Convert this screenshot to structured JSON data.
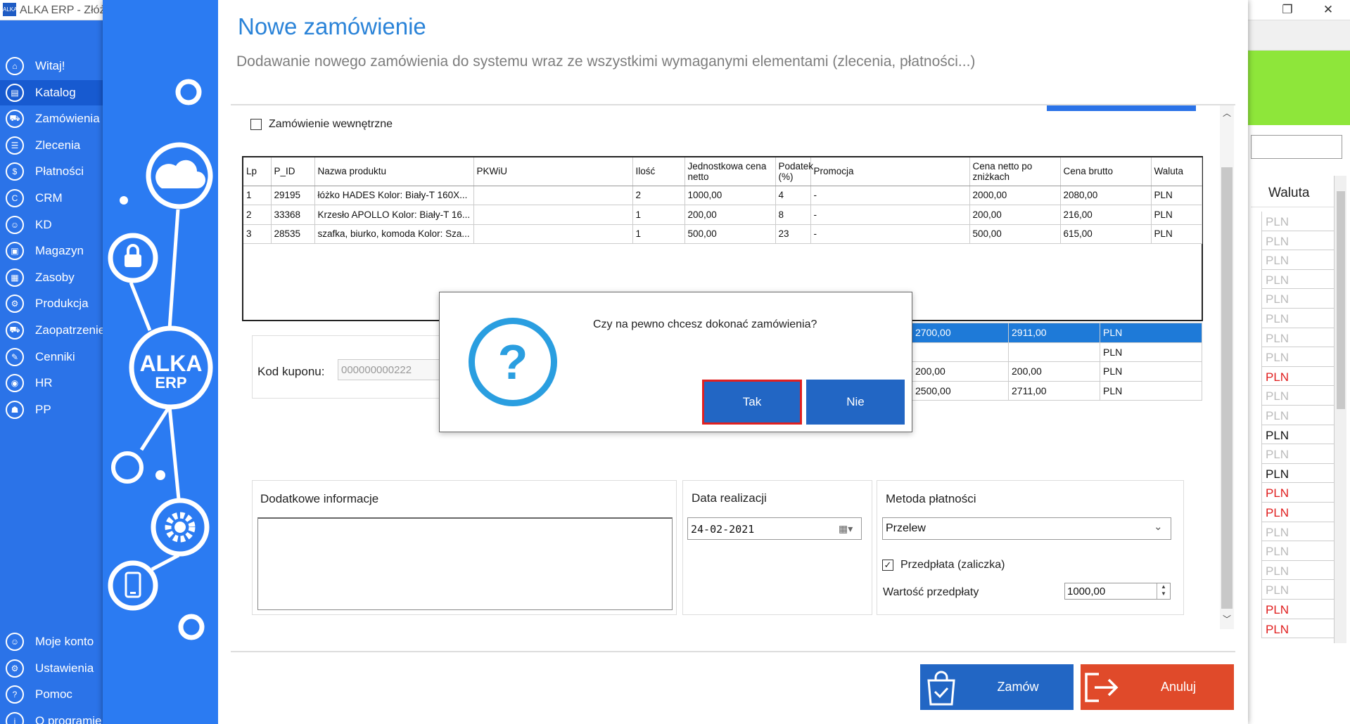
{
  "app_title": "ALKA ERP - Złóż z",
  "app_icon": "ALKA",
  "sidebar": {
    "items": [
      {
        "label": "Witaj!",
        "icon": "home-icon",
        "glyph": "⌂"
      },
      {
        "label": "Katalog",
        "icon": "book-icon",
        "glyph": "▤"
      },
      {
        "label": "Zamówienia",
        "icon": "cart-icon",
        "glyph": "⛟"
      },
      {
        "label": "Zlecenia",
        "icon": "list-icon",
        "glyph": "☰"
      },
      {
        "label": "Płatności",
        "icon": "dollar-icon",
        "glyph": "$"
      },
      {
        "label": "CRM",
        "icon": "crm-icon",
        "glyph": "C"
      },
      {
        "label": "KD",
        "icon": "person-icon",
        "glyph": "☺"
      },
      {
        "label": "Magazyn",
        "icon": "warehouse-icon",
        "glyph": "▣"
      },
      {
        "label": "Zasoby",
        "icon": "resources-icon",
        "glyph": "▦"
      },
      {
        "label": "Produkcja",
        "icon": "production-icon",
        "glyph": "⚙"
      },
      {
        "label": "Zaopatrzenie",
        "icon": "truck-icon",
        "glyph": "⛟"
      },
      {
        "label": "Cenniki",
        "icon": "tag-icon",
        "glyph": "✎"
      },
      {
        "label": "HR",
        "icon": "hr-icon",
        "glyph": "◉"
      },
      {
        "label": "PP",
        "icon": "pp-icon",
        "glyph": "☗"
      }
    ],
    "bottom_items": [
      {
        "label": "Moje konto",
        "icon": "account-icon",
        "glyph": "☺"
      },
      {
        "label": "Ustawienia",
        "icon": "settings-icon",
        "glyph": "⚙"
      },
      {
        "label": "Pomoc",
        "icon": "help-icon",
        "glyph": "?"
      },
      {
        "label": "O programie",
        "icon": "info-icon",
        "glyph": "i"
      }
    ]
  },
  "background_list": {
    "column_header": "Waluta",
    "cells": [
      {
        "v": "PLN",
        "c": "grey"
      },
      {
        "v": "PLN",
        "c": "grey"
      },
      {
        "v": "PLN",
        "c": "grey"
      },
      {
        "v": "PLN",
        "c": "grey"
      },
      {
        "v": "PLN",
        "c": "grey"
      },
      {
        "v": "PLN",
        "c": "grey"
      },
      {
        "v": "PLN",
        "c": "grey"
      },
      {
        "v": "PLN",
        "c": "grey"
      },
      {
        "v": "PLN",
        "c": "red"
      },
      {
        "v": "PLN",
        "c": "grey"
      },
      {
        "v": "PLN",
        "c": "grey"
      },
      {
        "v": "PLN",
        "c": "black"
      },
      {
        "v": "PLN",
        "c": "grey"
      },
      {
        "v": "PLN",
        "c": "black"
      },
      {
        "v": "PLN",
        "c": "red"
      },
      {
        "v": "PLN",
        "c": "red"
      },
      {
        "v": "PLN",
        "c": "grey"
      },
      {
        "v": "PLN",
        "c": "grey"
      },
      {
        "v": "PLN",
        "c": "grey"
      },
      {
        "v": "PLN",
        "c": "grey"
      },
      {
        "v": "PLN",
        "c": "red"
      },
      {
        "v": "PLN",
        "c": "red"
      }
    ]
  },
  "dialog": {
    "logo_line1": "ALKA",
    "logo_line2": "ERP",
    "title": "Nowe zamówienie",
    "subtitle": "Dodawanie nowego zamówienia do systemu wraz ze wszystkimi wymaganymi elementami (zlecenia, płatności...)",
    "internal_order_label": "Zamówienie wewnętrzne",
    "internal_order_checked": false,
    "grid": {
      "columns": [
        "Lp",
        "P_ID",
        "Nazwa produktu",
        "PKWiU",
        "Ilość",
        "Jednostkowa cena netto",
        "Podatek (%)",
        "Promocja",
        "Cena netto po zniżkach",
        "Cena brutto",
        "Waluta"
      ],
      "rows": [
        [
          "1",
          "29195",
          "łóżko HADES Kolor: Biały-T 160X...",
          "",
          "2",
          "1000,00",
          "4",
          "-",
          "2000,00",
          "2080,00",
          "PLN"
        ],
        [
          "2",
          "33368",
          "Krzesło APOLLO Kolor: Biały-T 16...",
          "",
          "1",
          "200,00",
          "8",
          "-",
          "200,00",
          "216,00",
          "PLN"
        ],
        [
          "3",
          "28535",
          "szafka, biurko, komoda Kolor: Sza...",
          "",
          "1",
          "500,00",
          "23",
          "-",
          "500,00",
          "615,00",
          "PLN"
        ]
      ]
    },
    "summary_rows": [
      [
        "2700,00",
        "2911,00",
        "PLN"
      ],
      [
        "",
        "",
        "PLN"
      ],
      [
        "200,00",
        "200,00",
        "PLN"
      ],
      [
        "2500,00",
        "2711,00",
        "PLN"
      ]
    ],
    "coupon_label": "Kod kuponu:",
    "coupon_value": "000000000222",
    "info_title": "Dodatkowe informacje",
    "date_title": "Data realizacji",
    "date_value": "24-02-2021",
    "payment_title": "Metoda płatności",
    "payment_value": "Przelew",
    "prepay_label": "Przedpłata (zaliczka)",
    "prepay_checked": true,
    "prepay_value_label": "Wartość przedpłaty",
    "prepay_value": "1000,00",
    "order_button": "Zamów",
    "cancel_button": "Anuluj"
  },
  "modal": {
    "message": "Czy na pewno chcesz dokonać zamówienia?",
    "yes": "Tak",
    "no": "Nie"
  },
  "colors": {
    "accent": "#2b73e8",
    "title": "#2a83d8",
    "danger": "#e04a2a",
    "highlight": "#1e7ad8",
    "green": "#8ee63a"
  }
}
